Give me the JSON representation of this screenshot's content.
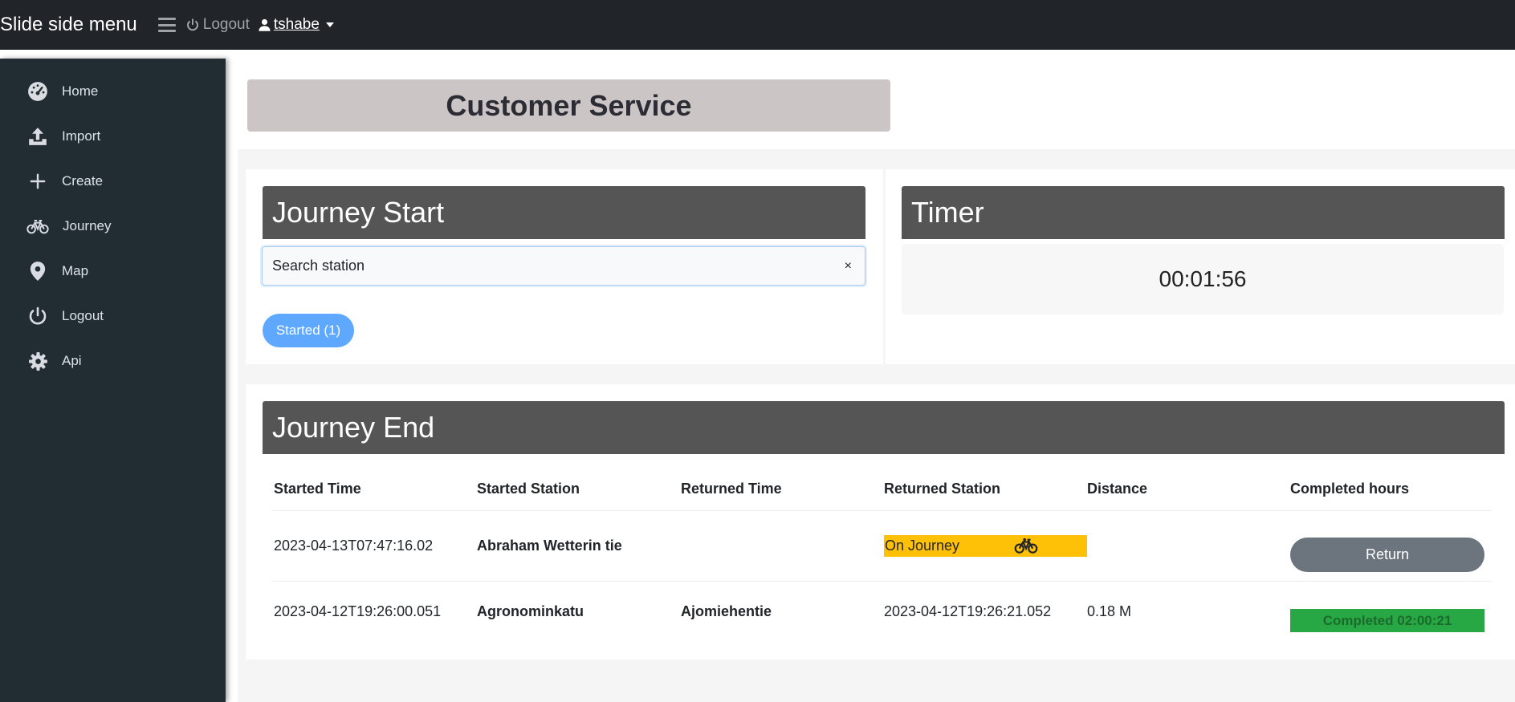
{
  "navbar": {
    "brand": "Slide side menu",
    "logout_label": "Logout",
    "username": "tshabe"
  },
  "sidebar": {
    "items": [
      {
        "label": "Home",
        "icon": "dashboard-icon"
      },
      {
        "label": "Import",
        "icon": "upload-icon"
      },
      {
        "label": "Create",
        "icon": "plus-icon"
      },
      {
        "label": "Journey",
        "icon": "bicycle-icon"
      },
      {
        "label": "Map",
        "icon": "map-pin-icon"
      },
      {
        "label": "Logout",
        "icon": "power-icon"
      },
      {
        "label": "Api",
        "icon": "gear-icon"
      }
    ]
  },
  "page": {
    "title": "Customer Service"
  },
  "journey_start": {
    "title": "Journey Start",
    "search_placeholder": "Search station",
    "clear_symbol": "×",
    "started_label": "Started (1)"
  },
  "timer": {
    "title": "Timer",
    "value": "00:01:56"
  },
  "journey_end": {
    "title": "Journey End",
    "columns": [
      "Started Time",
      "Started Station",
      "Returned Time",
      "Returned Station",
      "Distance",
      "Completed hours"
    ],
    "rows": [
      {
        "started_time": "2023-04-13T07:47:16.02",
        "started_station": "Abraham Wetterin tie",
        "returned_time": "",
        "returned_station": "On Journey",
        "distance": "",
        "completed": "Return"
      },
      {
        "started_time": "2023-04-12T19:26:00.051",
        "started_station": "Agronominkatu",
        "returned_time": "Ajomiehentie",
        "returned_station": "2023-04-12T19:26:21.052",
        "distance": "0.18 M",
        "completed": "Completed 02:00:21"
      }
    ]
  },
  "colors": {
    "navbar": "#212529",
    "sidebar": "#212c33",
    "panel_header": "#555555",
    "title_banner": "#cbc5c5",
    "pill": "#5fa8ff",
    "on_journey": "#ffc107",
    "return_button": "#6c757d",
    "completed": "#28a745"
  }
}
